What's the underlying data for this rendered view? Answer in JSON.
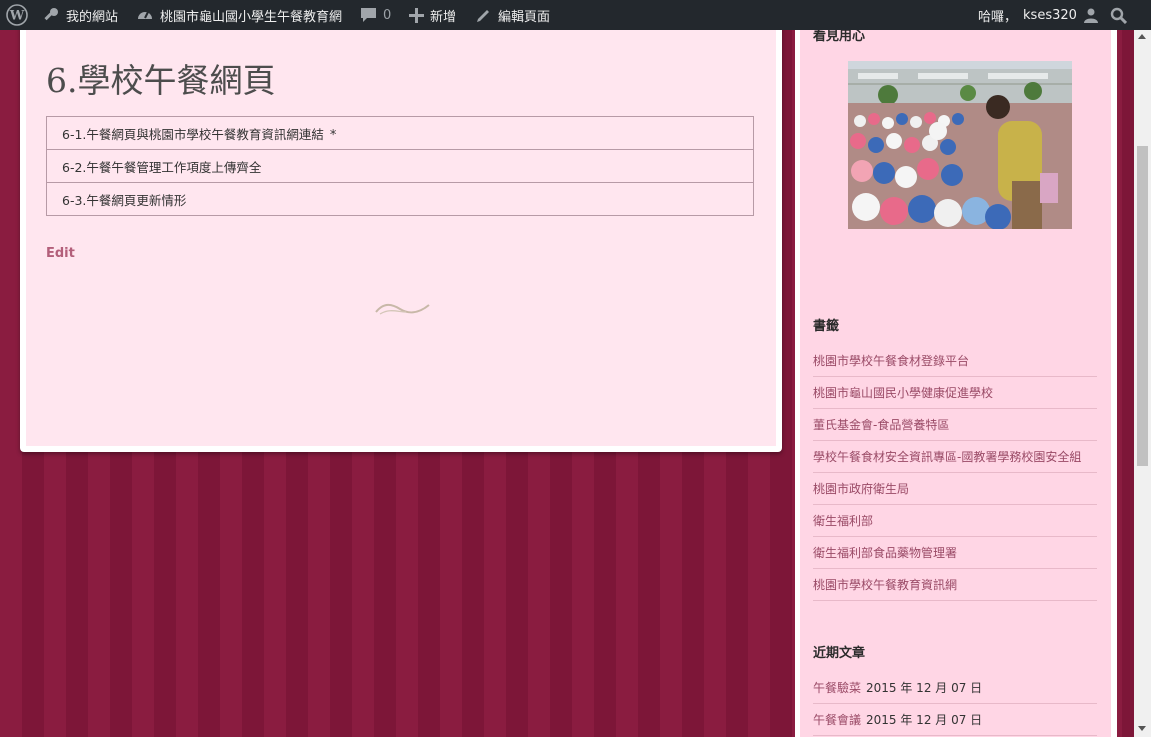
{
  "adminbar": {
    "my_sites": "我的網站",
    "site_name": "桃園市龜山國小學生午餐教育網",
    "comments_count": "0",
    "new_label": "新增",
    "edit_page": "編輯頁面",
    "greeting": "哈囉，",
    "username": "kses320"
  },
  "page": {
    "title": "6.學校午餐網頁",
    "links": [
      {
        "label": "6-1.午餐網頁與桃園市學校午餐教育資訊網連結",
        "mark": "*"
      },
      {
        "label": "6-2.午餐午餐管理工作項度上傳齊全"
      },
      {
        "label": "6-3.午餐網頁更新情形"
      }
    ],
    "edit_label": "Edit"
  },
  "sidebar": {
    "widget1_title": "看見用心",
    "blogroll_title": "書籤",
    "blogroll": [
      "桃園市學校午餐食材登錄平台",
      "桃園市龜山國民小學健康促進學校",
      "董氏基金會-食品營養特區",
      "學校午餐食材安全資訊專區-國教署學務校園安全組",
      "桃園市政府衛生局",
      "衛生福利部",
      "衛生福利部食品藥物管理署",
      "桃園市學校午餐教育資訊網"
    ],
    "recent_title": "近期文章",
    "recent_posts": [
      {
        "title": "午餐驗菜",
        "date": "2015 年 12 月 07 日"
      },
      {
        "title": "午餐會議",
        "date": "2015 年 12 月 07 日"
      }
    ]
  },
  "colors": {
    "admin_bar": "#23282d",
    "background_stripe": "#8a1c40",
    "content_bg": "#ffe6ef",
    "sidebar_bg": "#ffd6e5",
    "link": "#9a4a66"
  },
  "icons": [
    "wordpress-icon",
    "key-icon",
    "dashboard-icon",
    "comment-icon",
    "plus-icon",
    "pencil-icon",
    "user-icon",
    "search-icon"
  ]
}
